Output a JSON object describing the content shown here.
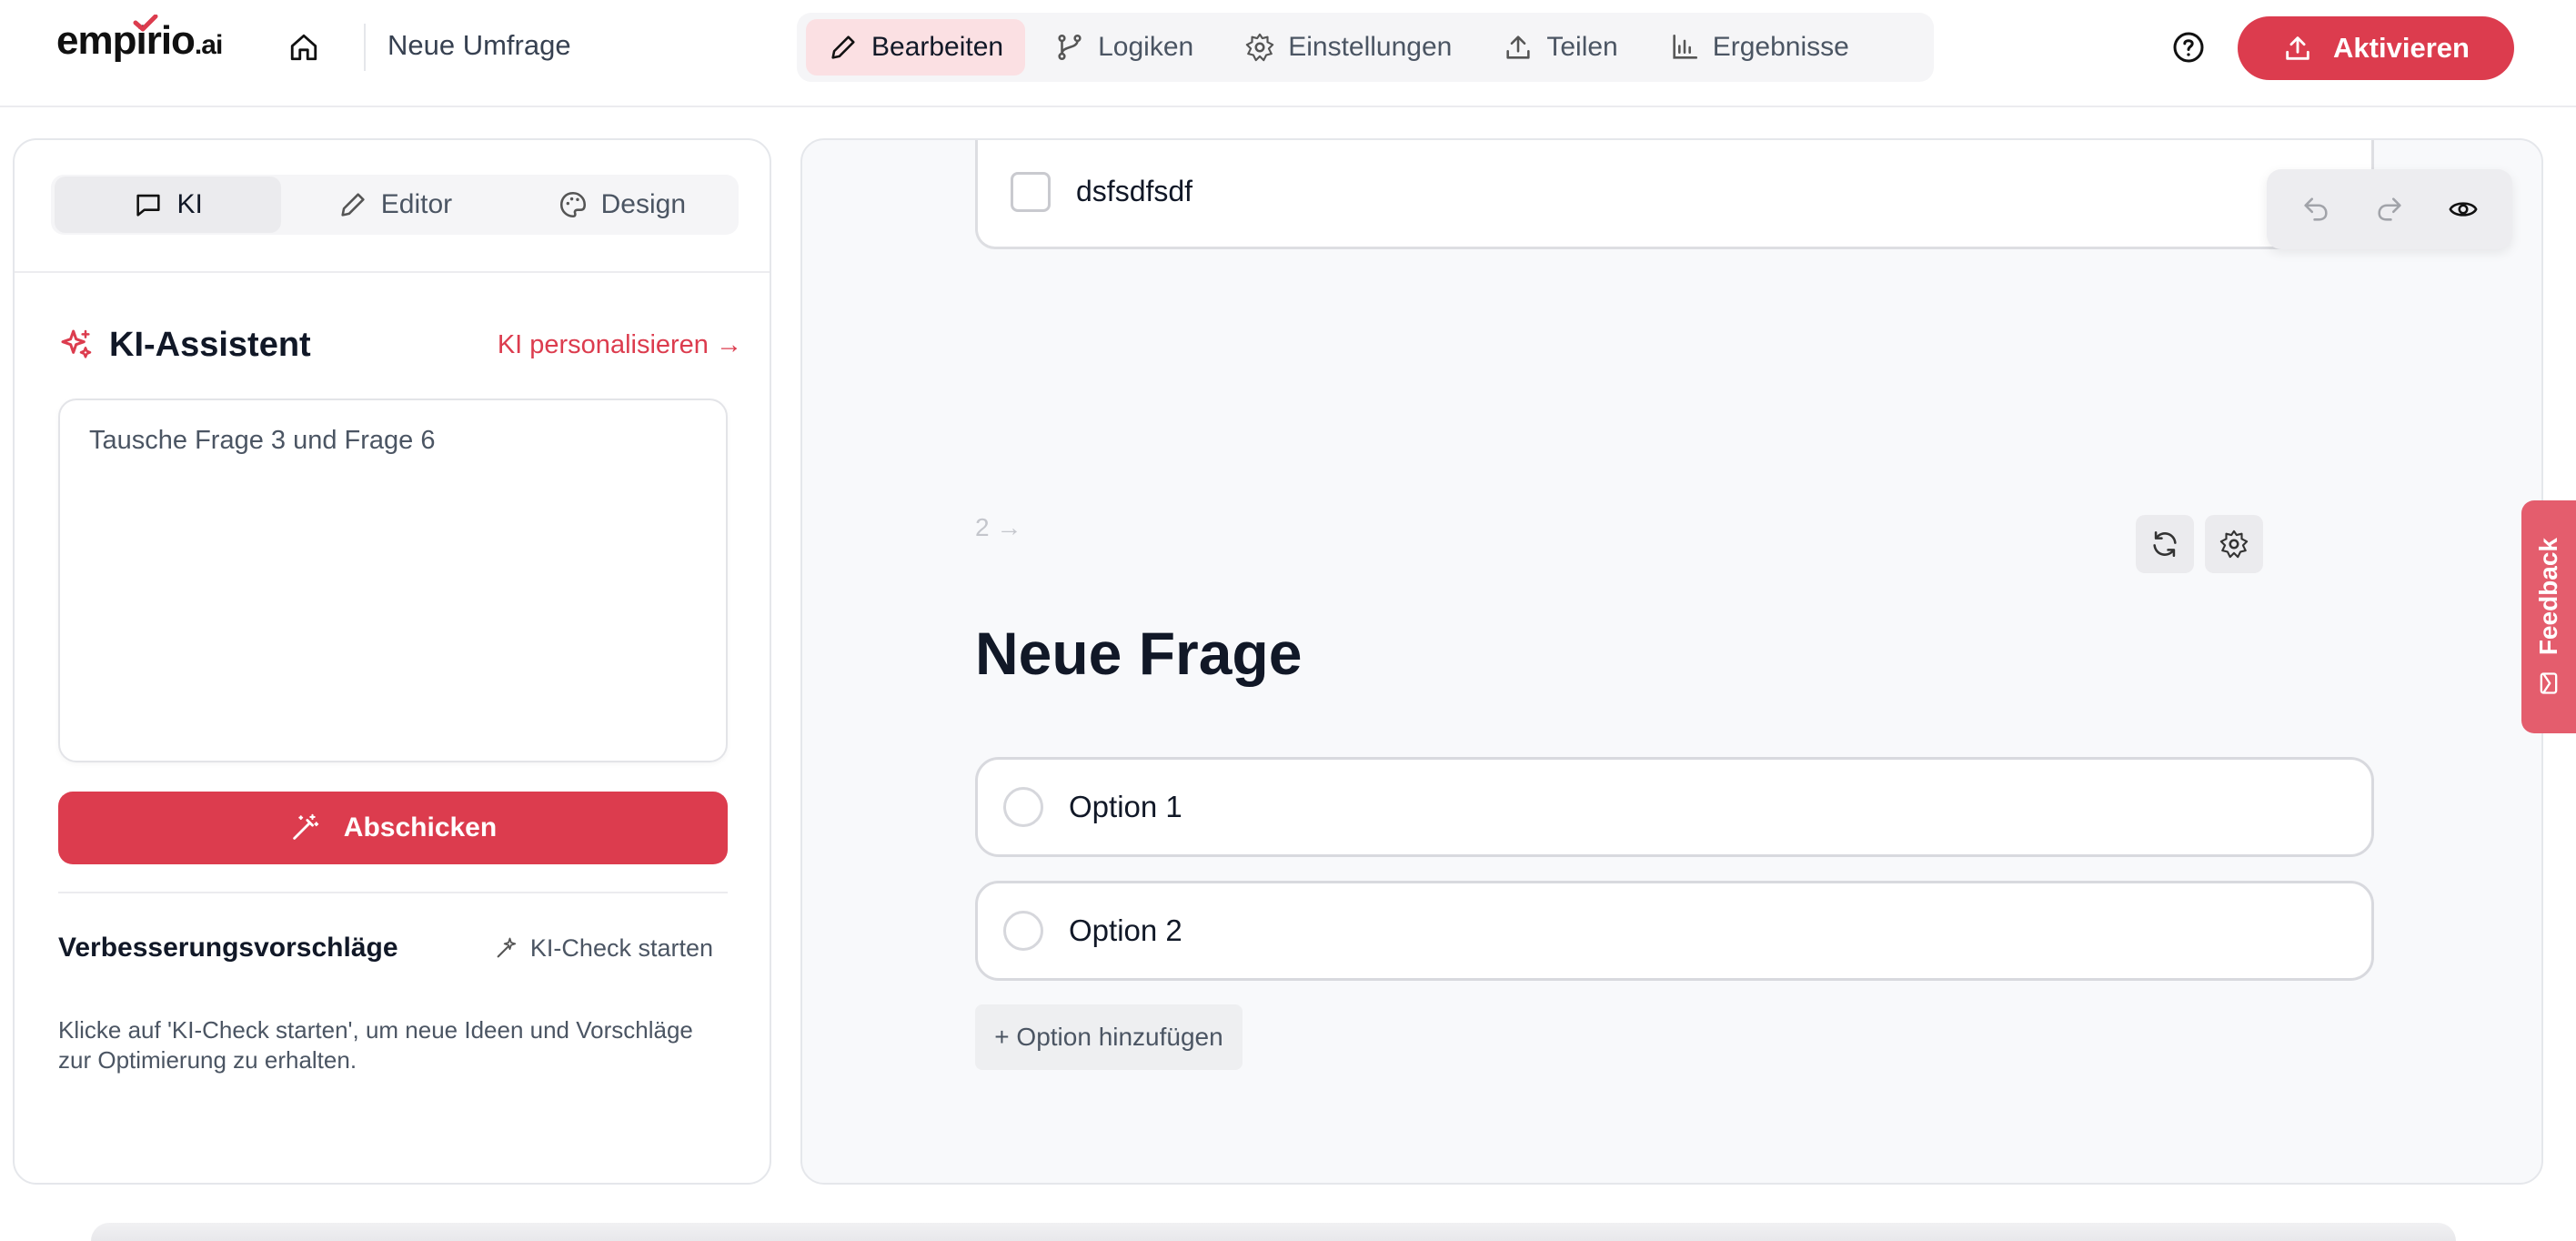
{
  "header": {
    "logo_text": "empirio",
    "logo_suffix": ".ai",
    "survey_title": "Neue Umfrage",
    "nav": [
      {
        "label": "Bearbeiten",
        "icon": "pencil-icon",
        "active": true
      },
      {
        "label": "Logiken",
        "icon": "branch-icon",
        "active": false
      },
      {
        "label": "Einstellungen",
        "icon": "gear-icon",
        "active": false
      },
      {
        "label": "Teilen",
        "icon": "upload-icon",
        "active": false
      },
      {
        "label": "Ergebnisse",
        "icon": "bar-chart-icon",
        "active": false
      }
    ],
    "activate_label": "Aktivieren"
  },
  "left_panel": {
    "tabs": [
      {
        "label": "KI",
        "icon": "chat-icon",
        "active": true
      },
      {
        "label": "Editor",
        "icon": "pencil-icon",
        "active": false
      },
      {
        "label": "Design",
        "icon": "palette-icon",
        "active": false
      }
    ],
    "assistant_title": "KI-Assistent",
    "personalize_link": "KI personalisieren →",
    "prompt_value": "Tausche Frage 3 und Frage 6",
    "submit_label": "Abschicken",
    "suggestions_title": "Verbesserungsvorschläge",
    "check_label": "KI-Check starten",
    "hint_text": "Klicke auf 'KI-Check starten', um neue Ideen und Vorschläge zur Optimierung zu erhalten."
  },
  "canvas": {
    "prev_option_text": "dsfsdfsdf",
    "question_number": "2 →",
    "question_title": "Neue Frage",
    "options": [
      "Option 1",
      "Option 2"
    ],
    "add_option_label": "+ Option hinzufügen"
  },
  "feedback_label": "Feedback",
  "colors": {
    "brand": "#dc3c4e",
    "nav_active_bg": "#fbe0e3",
    "canvas_bg": "#f8f9fb"
  }
}
